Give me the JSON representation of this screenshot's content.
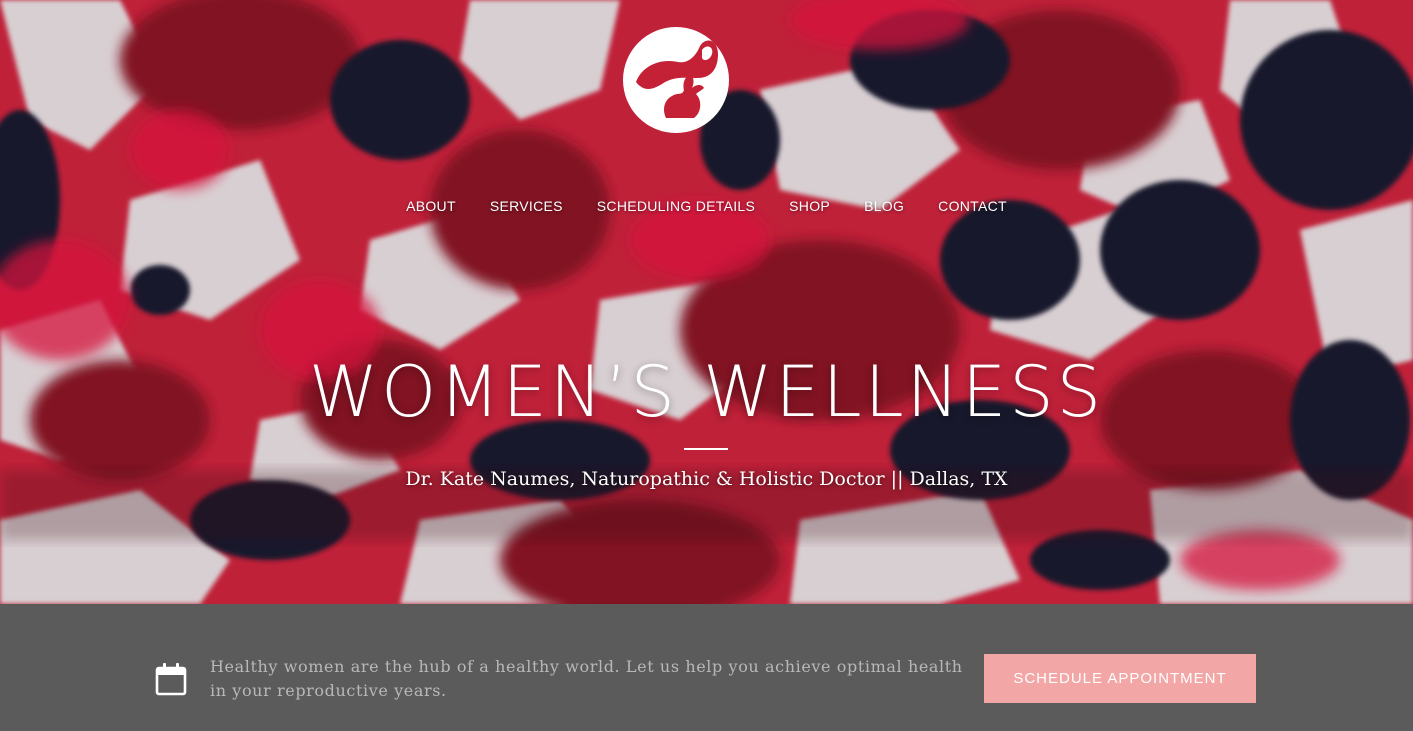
{
  "header": {
    "logo_icon": "rabbit-circle-logo",
    "nav": [
      {
        "label": "ABOUT"
      },
      {
        "label": "SERVICES"
      },
      {
        "label": "SCHEDULING DETAILS"
      },
      {
        "label": "SHOP"
      },
      {
        "label": "BLOG"
      },
      {
        "label": "CONTACT"
      }
    ]
  },
  "hero": {
    "title": "WOMEN’S WELLNESS",
    "subtitle": "Dr. Kate Naumes, Naturopathic & Holistic Doctor || Dallas, TX",
    "background": "red-black-ink-floral-fabric"
  },
  "cta": {
    "icon": "calendar-icon",
    "text": "Healthy women are the hub of a healthy world.  Let us help you achieve optimal health in your reproductive years.",
    "button_label": "SCHEDULE APPOINTMENT"
  },
  "colors": {
    "cta_bar": "#5b5b5b",
    "button": "#f2a7a6",
    "cta_text": "#b8b8b8"
  }
}
